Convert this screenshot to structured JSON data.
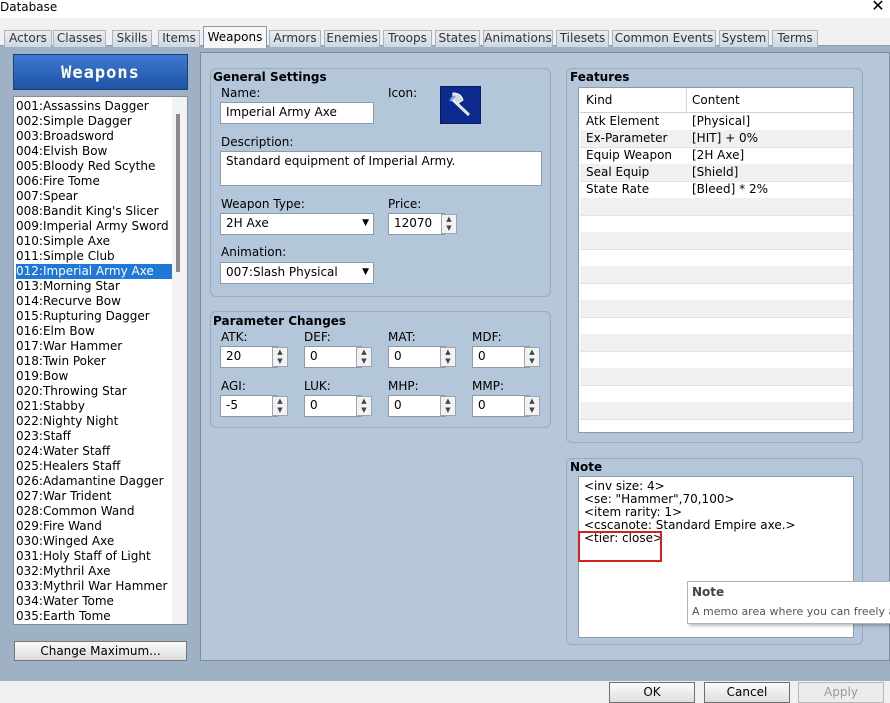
{
  "window": {
    "title": "Database",
    "close_glyph": "✕"
  },
  "tabs": [
    "Actors",
    "Classes",
    "Skills",
    "Items",
    "Weapons",
    "Armors",
    "Enemies",
    "Troops",
    "States",
    "Animations",
    "Tilesets",
    "Common Events",
    "System",
    "Terms"
  ],
  "active_tab": "Weapons",
  "list": {
    "header": "Weapons",
    "selected_index": 11,
    "items": [
      "001:Assassins Dagger",
      "002:Simple Dagger",
      "003:Broadsword",
      "004:Elvish Bow",
      "005:Bloody Red Scythe",
      "006:Fire Tome",
      "007:Spear",
      "008:Bandit King's Slicer",
      "009:Imperial Army Sword",
      "010:Simple Axe",
      "011:Simple Club",
      "012:Imperial Army Axe",
      "013:Morning Star",
      "014:Recurve Bow",
      "015:Rupturing Dagger",
      "016:Elm Bow",
      "017:War Hammer",
      "018:Twin Poker",
      "019:Bow",
      "020:Throwing Star",
      "021:Stabby",
      "022:Nighty Night",
      "023:Staff",
      "024:Water Staff",
      "025:Healers Staff",
      "026:Adamantine Dagger",
      "027:War Trident",
      "028:Common Wand",
      "029:Fire Wand",
      "030:Winged Axe",
      "031:Holy Staff of Light",
      "032:Mythril Axe",
      "033:Mythril War Hammer",
      "034:Water Tome",
      "035:Earth Tome"
    ],
    "change_max_label": "Change Maximum..."
  },
  "general": {
    "title": "General Settings",
    "name_label": "Name:",
    "name_value": "Imperial Army Axe",
    "icon_label": "Icon:",
    "icon_name": "axe-icon",
    "description_label": "Description:",
    "description_value": "Standard equipment of Imperial Army.",
    "weapon_type_label": "Weapon Type:",
    "weapon_type_value": "2H Axe",
    "price_label": "Price:",
    "price_value": "12070",
    "animation_label": "Animation:",
    "animation_value": "007:Slash Physical"
  },
  "params": {
    "title": "Parameter Changes",
    "fields": [
      {
        "label": "ATK:",
        "value": "20"
      },
      {
        "label": "DEF:",
        "value": "0"
      },
      {
        "label": "MAT:",
        "value": "0"
      },
      {
        "label": "MDF:",
        "value": "0"
      },
      {
        "label": "AGI:",
        "value": "-5"
      },
      {
        "label": "LUK:",
        "value": "0"
      },
      {
        "label": "MHP:",
        "value": "0"
      },
      {
        "label": "MMP:",
        "value": "0"
      }
    ]
  },
  "features": {
    "title": "Features",
    "col_kind": "Kind",
    "col_content": "Content",
    "rows": [
      {
        "kind": "Atk Element",
        "content": "[Physical]"
      },
      {
        "kind": "Ex-Parameter",
        "content": "[HIT] + 0%"
      },
      {
        "kind": "Equip Weapon",
        "content": "[2H Axe]"
      },
      {
        "kind": "Seal Equip",
        "content": "[Shield]"
      },
      {
        "kind": "State Rate",
        "content": "[Bleed] * 2%"
      }
    ]
  },
  "note": {
    "title": "Note",
    "lines": [
      "<inv size: 4>",
      "<se: \"Hammer\",70,100>",
      "<item rarity: 1>",
      "<cscanote: Standard Empire axe.>",
      "<tier: close>"
    ],
    "highlight_color": "#d62020"
  },
  "tooltip": {
    "title": "Note",
    "body": "A memo area where you can freely add"
  },
  "buttons": {
    "ok": "OK",
    "cancel": "Cancel",
    "apply": "Apply"
  },
  "colors": {
    "selection": "#1f78d8",
    "header_blue": "#2a63b8",
    "panel": "#b3c6da"
  }
}
